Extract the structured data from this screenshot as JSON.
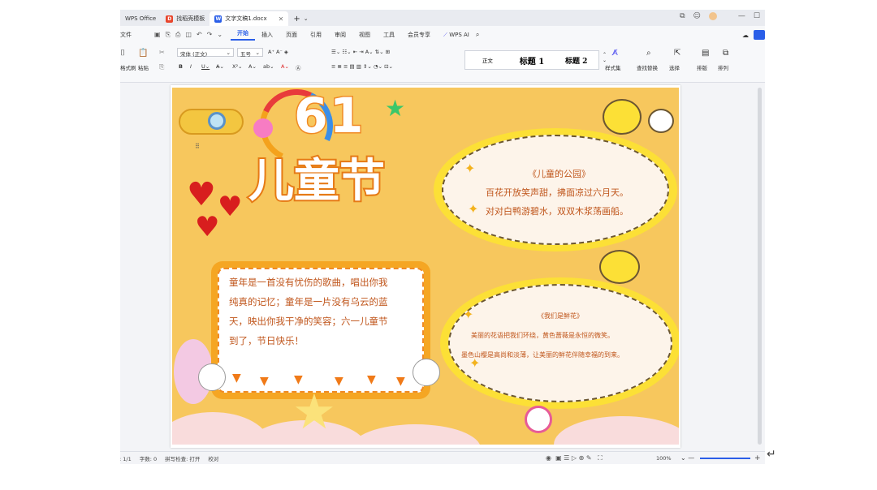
{
  "tabs": [
    {
      "label": "WPS Office",
      "icon": "wps-logo-icon",
      "color": "#e0e3e8"
    },
    {
      "label": "找稻壳模板",
      "icon": "docer-icon",
      "color": "#e8452c"
    },
    {
      "label": "文字文稿1.docx",
      "icon": "word-doc-icon",
      "color": "#2a5ee8"
    }
  ],
  "menu": {
    "file": "文件",
    "items": [
      "开始",
      "插入",
      "页面",
      "引用",
      "审阅",
      "视图",
      "工具",
      "会员专享"
    ],
    "active": "开始",
    "ai": "WPS AI"
  },
  "ribbon": {
    "format_painter": "格式刷",
    "paste": "粘贴",
    "font_name": "宋体 (正文)",
    "font_size": "五号",
    "styles": [
      "正文",
      "标题 1",
      "标题 2"
    ],
    "style_set": "样式集",
    "find_replace": "查找替换",
    "select": "选择",
    "layout": "排版",
    "arrange": "排列"
  },
  "poster": {
    "number": "61",
    "title": "儿童节",
    "poem1_title": "《儿童的公园》",
    "poem1_line1": "百花开放笑声甜，拂面凉过六月天。",
    "poem1_line2": "对对白鸭游碧水，双双木浆荡画船。",
    "main_line1": "童年是一首没有忧伤的歌曲，唱出你我",
    "main_line2": "纯真的记忆；童年是一片没有乌云的蓝",
    "main_line3": "天，映出你我干净的笑容；六一儿童节",
    "main_line4": "到了，节日快乐！",
    "poem2_title": "《我们是鲜花》",
    "poem2_line1": "美丽的花语把我们环绕，黄色蔷薇是永恒的微笑。",
    "poem2_line2": "墨色山樱是高尚和淡薄，让美丽的鲜花伴随幸福的到来。"
  },
  "status": {
    "page": "页面: 1/1",
    "words": "字数: 0",
    "spell": "拼写检查: 打开",
    "proof": "校对",
    "zoom": "100%"
  },
  "colors": {
    "accent": "#2a5ee8",
    "poster_bg": "#f7c75d",
    "poster_text": "#c0561c"
  }
}
